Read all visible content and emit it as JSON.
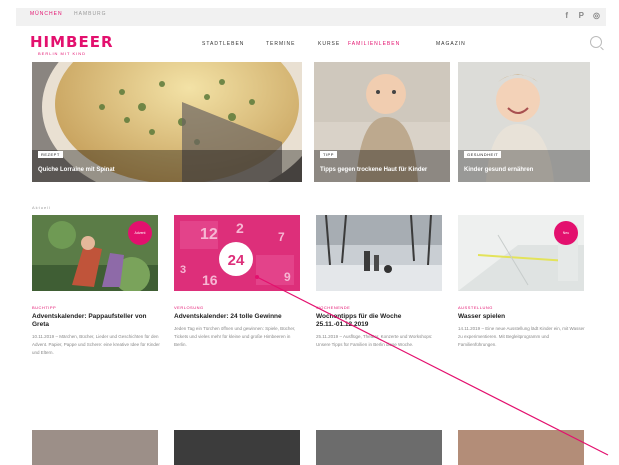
{
  "topbar": {
    "tabs": [
      "München",
      "Hamburg"
    ],
    "social": [
      "f",
      "P",
      "◎"
    ]
  },
  "header": {
    "logo": "HIMBEER",
    "logo_sub": "BERLIN MIT KIND",
    "nav": [
      "Stadtleben",
      "Termine",
      "Kurse",
      "Familienleben",
      "Magazin"
    ],
    "active_nav": 3
  },
  "features": [
    {
      "tag": "Rezept",
      "title": "Quiche Lorraine mit Spinat"
    },
    {
      "tag": "Tipp",
      "title": "Tipps gegen trockene Haut für Kinder"
    },
    {
      "tag": "Gesundheit",
      "title": "Kinder gesund ernähren"
    }
  ],
  "section_label": "Aktuell",
  "cards": [
    {
      "category": "Buchtipp",
      "title": "Adventskalender: Pappaufsteller von Greta",
      "text": "10.11.2019 – Märchen, Bücher, Lieder und Geschichten für den Advent. Papier, Pappe und Schere: eine kreative Idee für Kinder und Eltern.",
      "badge": "Advent"
    },
    {
      "category": "Verlosung",
      "title": "Adventskalender: 24 tolle Gewinne",
      "text": "Jeden Tag ein Türchen öffnen und gewinnen: Spiele, Bücher, Tickets und vieles mehr für kleine und große Himbeeren in Berlin.",
      "number": "24"
    },
    {
      "category": "Wochenende",
      "title": "Wochentipps für die Woche 25.11.-01.12.2019",
      "text": "25.11.2019 – Ausflüge, Theater, Konzerte und Workshops: Unsere Tipps für Familien in Berlin diese Woche."
    },
    {
      "category": "Ausstellung",
      "title": "Wasser spielen",
      "text": "14.11.2019 – Eine neue Ausstellung lädt Kinder ein, mit Wasser zu experimentieren. Mit Begleitprogramm und Familienführungen.",
      "badge": "Neu"
    }
  ],
  "calendar_numbers": [
    "12",
    "2",
    "24",
    "16",
    "3",
    "7",
    "9"
  ],
  "colors": {
    "brand": "#e3106e",
    "topbar": "#f1f1f1"
  }
}
